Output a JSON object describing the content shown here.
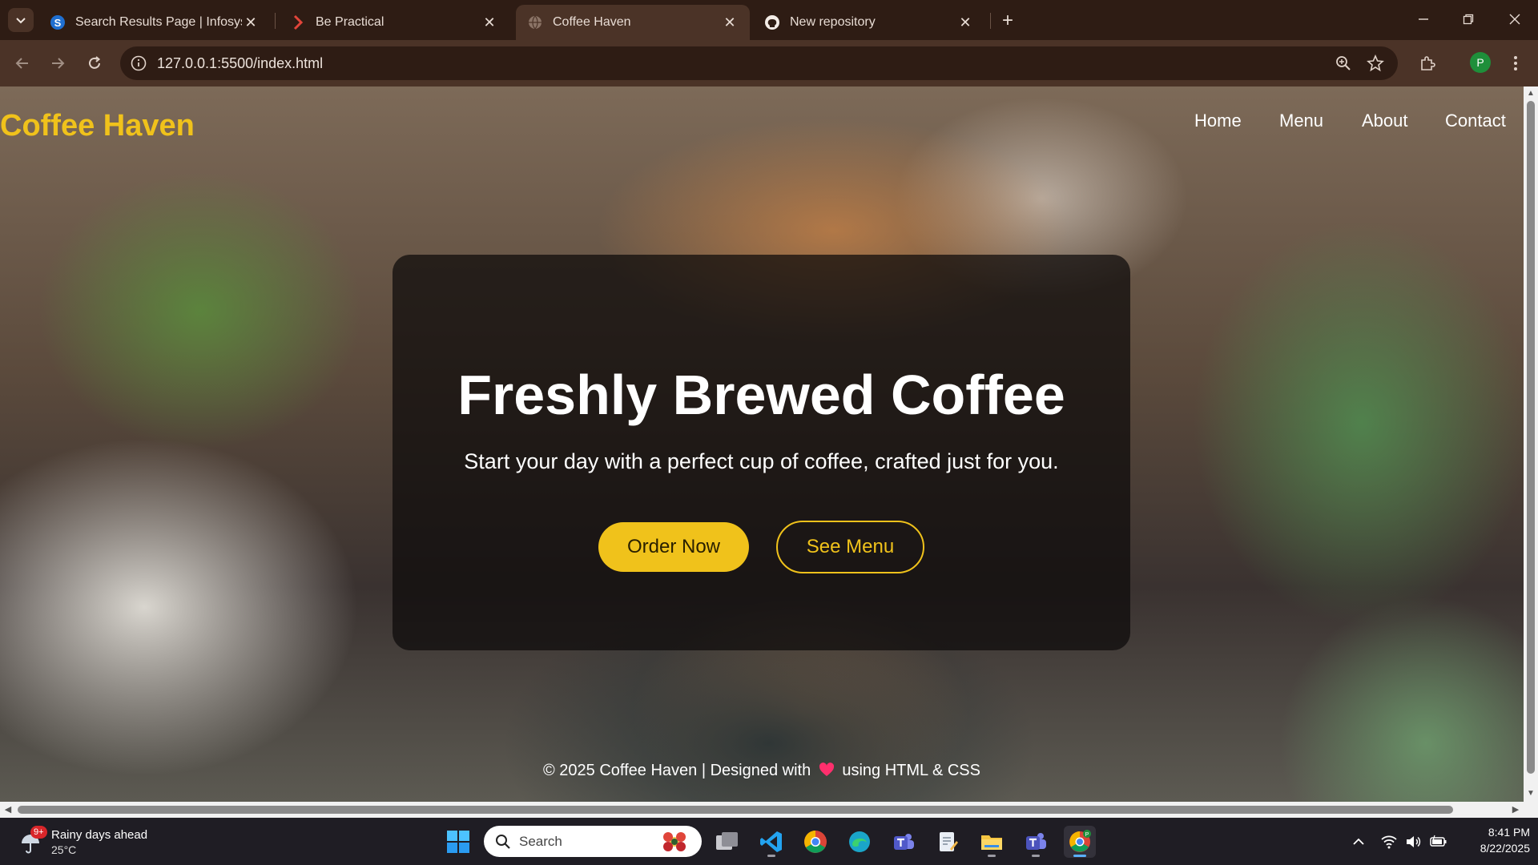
{
  "browser": {
    "tabs": [
      {
        "title": "Search Results Page | Infosys Sp",
        "icon": "infosys-springboard-icon"
      },
      {
        "title": "Be Practical",
        "icon": "be-practical-icon"
      },
      {
        "title": "Coffee Haven",
        "icon": "globe-icon",
        "active": true
      },
      {
        "title": "New repository",
        "icon": "github-icon"
      }
    ],
    "url": "127.0.0.1:5500/index.html",
    "profile_initial": "P"
  },
  "page": {
    "logo": "Coffee Haven",
    "nav": [
      "Home",
      "Menu",
      "About",
      "Contact"
    ],
    "hero": {
      "title": "Freshly Brewed Coffee",
      "subtitle": "Start your day with a perfect cup of coffee, crafted just for you.",
      "primary_button": "Order Now",
      "secondary_button": "See Menu"
    },
    "footer": {
      "before_heart": "© 2025 Coffee Haven | Designed with",
      "after_heart": "using HTML & CSS"
    },
    "colors": {
      "accent": "#f0c21b",
      "hero_overlay": "rgba(12,10,10,0.72)"
    }
  },
  "taskbar": {
    "weather": {
      "badge": "9+",
      "headline": "Rainy days ahead",
      "temp": "25°C"
    },
    "search_placeholder": "Search",
    "clock": {
      "time": "8:41 PM",
      "date": "8/22/2025"
    }
  }
}
